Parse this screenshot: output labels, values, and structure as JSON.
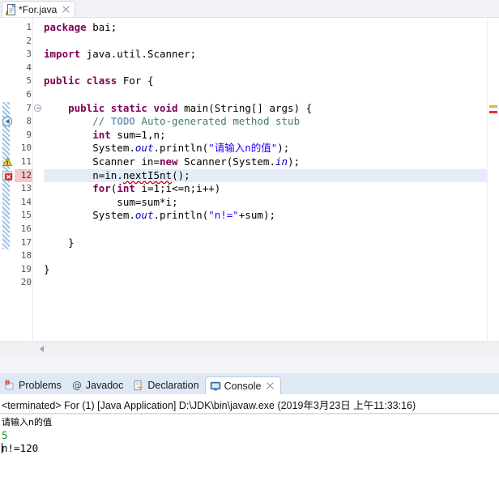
{
  "editor": {
    "tab": {
      "title": "*For.java",
      "icon": "java-file-warning-icon",
      "close": "close-icon"
    },
    "lines": [
      {
        "num": "1",
        "segments": [
          {
            "t": "kw",
            "s": "package"
          },
          {
            "t": "plain",
            "s": " bai;"
          }
        ]
      },
      {
        "num": "2",
        "segments": []
      },
      {
        "num": "3",
        "segments": [
          {
            "t": "kw",
            "s": "import"
          },
          {
            "t": "plain",
            "s": " java.util.Scanner;"
          }
        ]
      },
      {
        "num": "4",
        "segments": []
      },
      {
        "num": "5",
        "segments": [
          {
            "t": "kw",
            "s": "public class"
          },
          {
            "t": "plain",
            "s": " For {"
          }
        ]
      },
      {
        "num": "6",
        "segments": []
      },
      {
        "num": "7",
        "segments": [
          {
            "t": "plain",
            "s": "    "
          },
          {
            "t": "kw",
            "s": "public static void"
          },
          {
            "t": "plain",
            "s": " main(String[] args) {"
          }
        ]
      },
      {
        "num": "8",
        "segments": [
          {
            "t": "plain",
            "s": "        "
          },
          {
            "t": "cmt",
            "s": "// "
          },
          {
            "t": "todo",
            "s": "TODO"
          },
          {
            "t": "cmt",
            "s": " Auto-generated method stub"
          }
        ]
      },
      {
        "num": "9",
        "segments": [
          {
            "t": "plain",
            "s": "        "
          },
          {
            "t": "kw",
            "s": "int"
          },
          {
            "t": "plain",
            "s": " sum=1,n;"
          }
        ]
      },
      {
        "num": "10",
        "segments": [
          {
            "t": "plain",
            "s": "        System."
          },
          {
            "t": "fld",
            "s": "out"
          },
          {
            "t": "plain",
            "s": ".println("
          },
          {
            "t": "str",
            "s": "\"请输入n的值\""
          },
          {
            "t": "plain",
            "s": ");"
          }
        ]
      },
      {
        "num": "11",
        "segments": [
          {
            "t": "plain",
            "s": "        Scanner in="
          },
          {
            "t": "kw",
            "s": "new"
          },
          {
            "t": "plain",
            "s": " Scanner(System."
          },
          {
            "t": "fld",
            "s": "in"
          },
          {
            "t": "plain",
            "s": ");"
          }
        ]
      },
      {
        "num": "12",
        "segments": [
          {
            "t": "plain",
            "s": "        n=in."
          },
          {
            "t": "err",
            "s": "nextI5nt"
          },
          {
            "t": "plain",
            "s": "();"
          }
        ]
      },
      {
        "num": "13",
        "segments": [
          {
            "t": "plain",
            "s": "        "
          },
          {
            "t": "kw",
            "s": "for"
          },
          {
            "t": "plain",
            "s": "("
          },
          {
            "t": "kw",
            "s": "int"
          },
          {
            "t": "plain",
            "s": " i=1;i<=n;i++)"
          }
        ]
      },
      {
        "num": "14",
        "segments": [
          {
            "t": "plain",
            "s": "            sum=sum*i;"
          }
        ]
      },
      {
        "num": "15",
        "segments": [
          {
            "t": "plain",
            "s": "        System."
          },
          {
            "t": "fld",
            "s": "out"
          },
          {
            "t": "plain",
            "s": ".println("
          },
          {
            "t": "str",
            "s": "\"n!=\""
          },
          {
            "t": "plain",
            "s": "+sum);"
          }
        ]
      },
      {
        "num": "16",
        "segments": []
      },
      {
        "num": "17",
        "segments": [
          {
            "t": "plain",
            "s": "    }"
          }
        ]
      },
      {
        "num": "18",
        "segments": []
      },
      {
        "num": "19",
        "segments": [
          {
            "t": "plain",
            "s": "}"
          }
        ]
      },
      {
        "num": "20",
        "segments": []
      }
    ],
    "current_line": "12",
    "fold_line": "7",
    "markers": [
      {
        "line": "8",
        "name": "quickfix-marker"
      },
      {
        "line": "11",
        "name": "warning-marker"
      },
      {
        "line": "12",
        "name": "error-marker"
      }
    ],
    "scrollbar": {
      "left_arrow": "scroll-left-icon"
    }
  },
  "bottom": {
    "tabs": [
      {
        "label": "Problems",
        "icon": "problems-icon",
        "active": false
      },
      {
        "label": "Javadoc",
        "icon": "javadoc-at-icon",
        "active": false
      },
      {
        "label": "Declaration",
        "icon": "declaration-icon",
        "active": false
      },
      {
        "label": "Console",
        "icon": "console-icon",
        "active": true
      }
    ],
    "console": {
      "status": "<terminated> For (1) [Java Application] D:\\JDK\\bin\\javaw.exe (2019年3月23日 上午11:33:16)",
      "output": [
        {
          "kind": "prompt",
          "text": "请输入n的值"
        },
        {
          "kind": "input",
          "text": "5"
        },
        {
          "kind": "out",
          "text": "n!=120"
        }
      ]
    }
  },
  "colors": {
    "keyword": "#7f0055",
    "string": "#2a00ff",
    "comment": "#3f7f5f",
    "todo": "#7f9fbf",
    "field": "#0000c0",
    "error": "#d00000",
    "console_input": "#0a9a0a",
    "current_line_highlight": "#e4ecf9",
    "current_line_number": "#f6c6cf",
    "view_background": "#dfe8f5"
  }
}
